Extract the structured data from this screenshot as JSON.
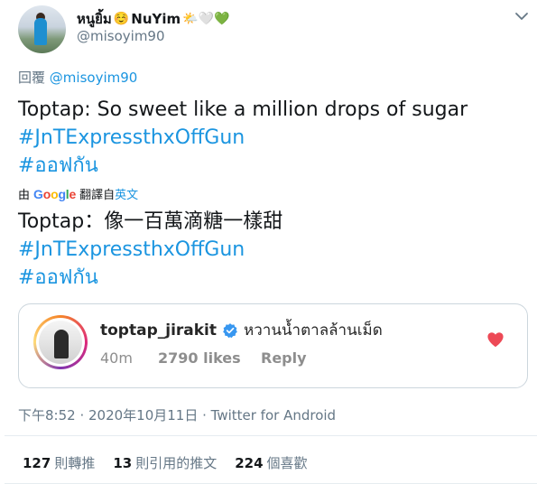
{
  "author": {
    "display_name": "หนูยิ้ม",
    "display_name_suffix": "NuYim",
    "emoji_smile": "☺️",
    "emoji_tail": "🌤️🤍💚",
    "username": "@misoyim90"
  },
  "reply": {
    "prefix": "回覆",
    "handle": "@misoyim90"
  },
  "tweet": {
    "line1": "Toptap: So sweet like a million drops of sugar",
    "hashtag1": "#JnTExpressthxOffGun",
    "hashtag2": "#ออฟกัน"
  },
  "translation": {
    "by_label": "由",
    "google": "Google",
    "translated_label": "翻譯自",
    "source_language": "英文",
    "line1": "Toptap：像一百萬滴糖一樣甜",
    "hashtag1": "#JnTExpressthxOffGun",
    "hashtag2": "#ออฟกัน"
  },
  "embedded_card": {
    "username": "toptap_jirakit",
    "comment": "หวานน้ำตาลล้านเม็ด",
    "time": "40m",
    "likes": "2790 likes",
    "reply_label": "Reply"
  },
  "meta": {
    "timestamp": "下午8:52 · 2020年10月11日 · Twitter for Android"
  },
  "stats": {
    "retweets_count": "127",
    "retweets_label": "則轉推",
    "quotes_count": "13",
    "quotes_label": "則引用的推文",
    "likes_count": "224",
    "likes_label": "個喜歡"
  },
  "colors": {
    "link": "#1b95e0",
    "secondary_text": "#657786",
    "heart": "#ed4956",
    "verified": "#3897f0"
  }
}
